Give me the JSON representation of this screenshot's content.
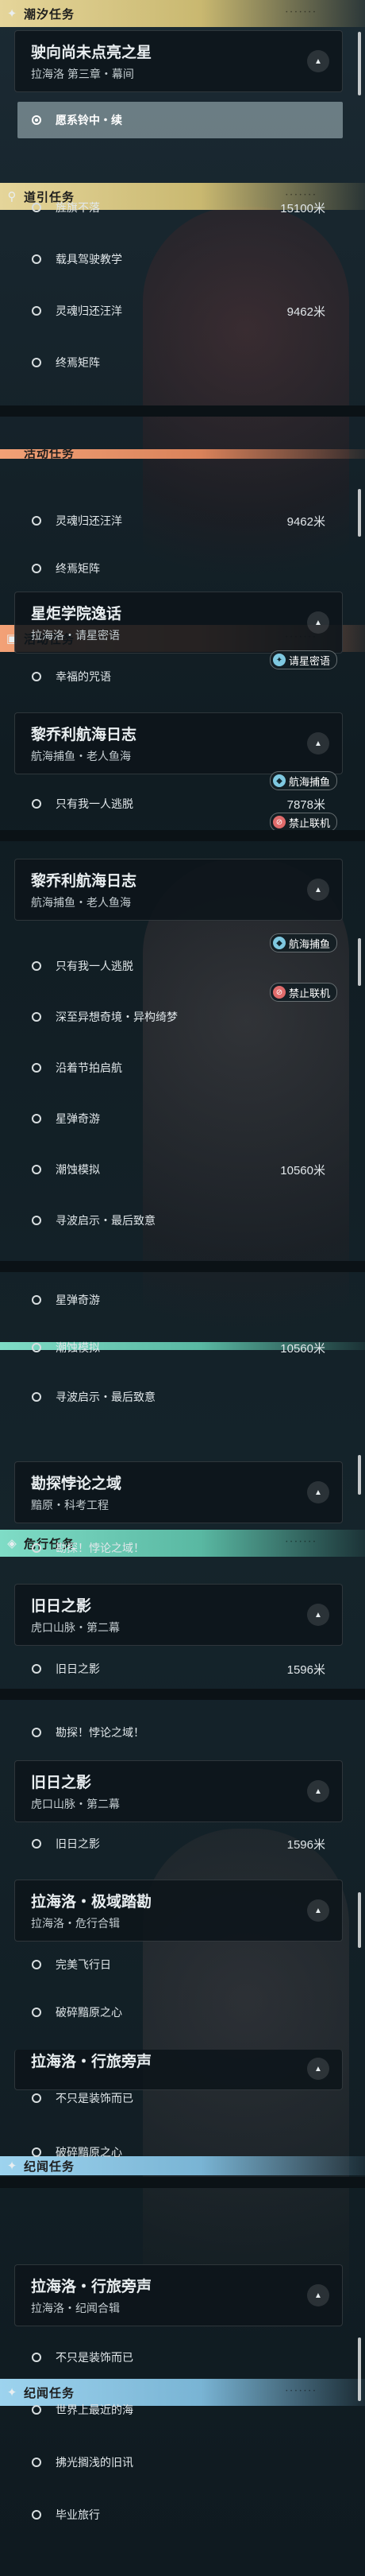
{
  "sections": {
    "tide": {
      "title": "潮汐任务"
    },
    "guide": {
      "title": "道引任务"
    },
    "event": {
      "title": "活动任务"
    },
    "danger": {
      "title": "危行任务"
    },
    "chronicle": {
      "title": "纪闻任务"
    }
  },
  "tide_quest": {
    "title": "驶向尚未点亮之星",
    "sub": "拉海洛 第三章・幕间",
    "step": "愿系铃中・续"
  },
  "guide_items": [
    {
      "label": "旌旗不落",
      "dist": "15100米"
    },
    {
      "label": "载具驾驶教学",
      "dist": ""
    },
    {
      "label": "灵魂归还汪洋",
      "dist": "9462米"
    },
    {
      "label": "终焉矩阵",
      "dist": ""
    }
  ],
  "event_quests": [
    {
      "title": "星炬学院逸话",
      "sub": "拉海洛・请星密语",
      "steps": [
        {
          "label": "幸福的咒语",
          "dist": ""
        }
      ]
    },
    {
      "title": "黎乔利航海日志",
      "sub": "航海捕鱼・老人鱼海",
      "steps": [
        {
          "label": "只有我一人逃脱",
          "dist": "7878米"
        },
        {
          "label": "深至异想奇境・异构绮梦",
          "dist": ""
        },
        {
          "label": "沿着节拍启航",
          "dist": ""
        },
        {
          "label": "星弹奇游",
          "dist": ""
        },
        {
          "label": "潮蚀模拟",
          "dist": "10560米"
        },
        {
          "label": "寻波启示・最后致意",
          "dist": ""
        }
      ]
    }
  ],
  "badges": {
    "star": "请星密语",
    "sea": "航海捕鱼",
    "ban": "禁止联机"
  },
  "danger_quests": [
    {
      "title": "勘探悖论之域",
      "sub": "黯原・科考工程",
      "steps": [
        {
          "label": "勘探！悖论之域！",
          "dist": ""
        }
      ]
    },
    {
      "title": "旧日之影",
      "sub": "虎口山脉・第二幕",
      "steps": [
        {
          "label": "旧日之影",
          "dist": "1596米"
        }
      ]
    },
    {
      "title": "拉海洛・极域踏勘",
      "sub": "拉海洛・危行合辑",
      "steps": [
        {
          "label": "完美飞行日",
          "dist": ""
        },
        {
          "label": "破碎黯原之心",
          "dist": ""
        }
      ]
    }
  ],
  "chronicle_quest": {
    "title": "拉海洛・行旅旁声",
    "sub": "拉海洛・纪闻合辑",
    "steps": [
      {
        "label": "不只是装饰而已",
        "dist": ""
      },
      {
        "label": "世界上最近的海",
        "dist": ""
      },
      {
        "label": "拂光搁浅的旧讯",
        "dist": ""
      },
      {
        "label": "毕业旅行",
        "dist": ""
      }
    ]
  },
  "icons": {
    "tide": "sparkle-icon",
    "guide": "location-pin-icon",
    "event": "calendar-icon",
    "danger": "diamond-icon",
    "chronicle": "sparkle-icon",
    "collapse": "chevron-up-icon"
  },
  "colors": {
    "tide": "#e5d59a",
    "guide": "#c9b870",
    "event": "#f2a176",
    "danger": "#7fdcc6",
    "chronicle": "#9dd3ee"
  }
}
